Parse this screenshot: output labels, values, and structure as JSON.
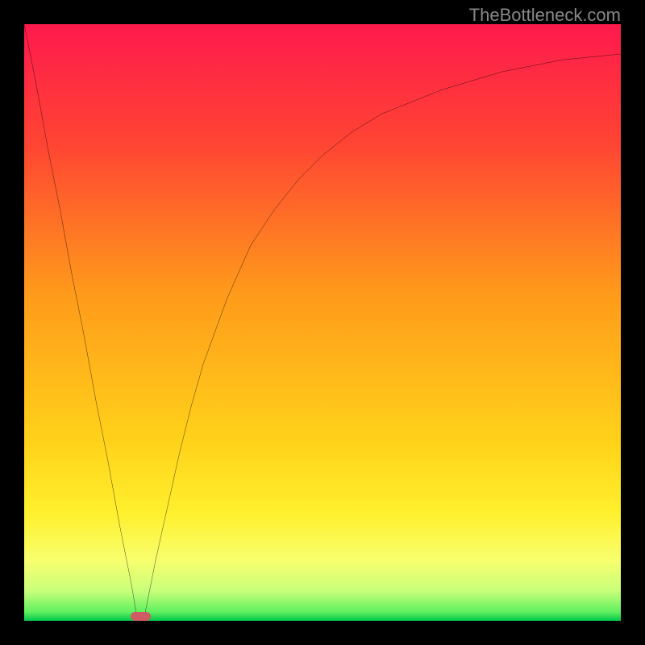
{
  "attribution": "TheBottleneck.com",
  "chart_data": {
    "type": "line",
    "title": "",
    "xlabel": "",
    "ylabel": "",
    "xlim": [
      0,
      100
    ],
    "ylim": [
      0,
      100
    ],
    "grid": false,
    "legend": false,
    "background_gradient": {
      "direction": "top-to-bottom",
      "stops": [
        {
          "pos": 0.0,
          "color": "#ff1a4d"
        },
        {
          "pos": 0.2,
          "color": "#ff4433"
        },
        {
          "pos": 0.45,
          "color": "#ff9a1a"
        },
        {
          "pos": 0.7,
          "color": "#ffd21a"
        },
        {
          "pos": 0.82,
          "color": "#fff02e"
        },
        {
          "pos": 0.9,
          "color": "#f7ff6e"
        },
        {
          "pos": 0.95,
          "color": "#c8ff7a"
        },
        {
          "pos": 0.985,
          "color": "#60f060"
        },
        {
          "pos": 1.0,
          "color": "#00c84a"
        }
      ]
    },
    "series": [
      {
        "name": "bottleneck-curve",
        "color": "#000000",
        "x": [
          0,
          2,
          4,
          6,
          8,
          10,
          12,
          14,
          16,
          18,
          19,
          20,
          21,
          22,
          24,
          26,
          28,
          30,
          34,
          38,
          42,
          46,
          50,
          55,
          60,
          65,
          70,
          75,
          80,
          85,
          90,
          95,
          100
        ],
        "y": [
          100,
          90,
          79,
          69,
          58,
          48,
          37,
          27,
          16,
          6,
          0,
          0,
          5,
          10,
          19,
          28,
          36,
          43,
          54,
          63,
          69,
          74,
          78,
          82,
          85,
          87,
          89,
          90.5,
          92,
          93,
          94,
          94.5,
          95
        ]
      }
    ],
    "marker": {
      "name": "optimal-point",
      "shape": "rounded-rect",
      "color": "#cf5b63",
      "x": 19.5,
      "y": 0,
      "width_x_units": 3.4,
      "height_y_units": 1.5
    }
  }
}
